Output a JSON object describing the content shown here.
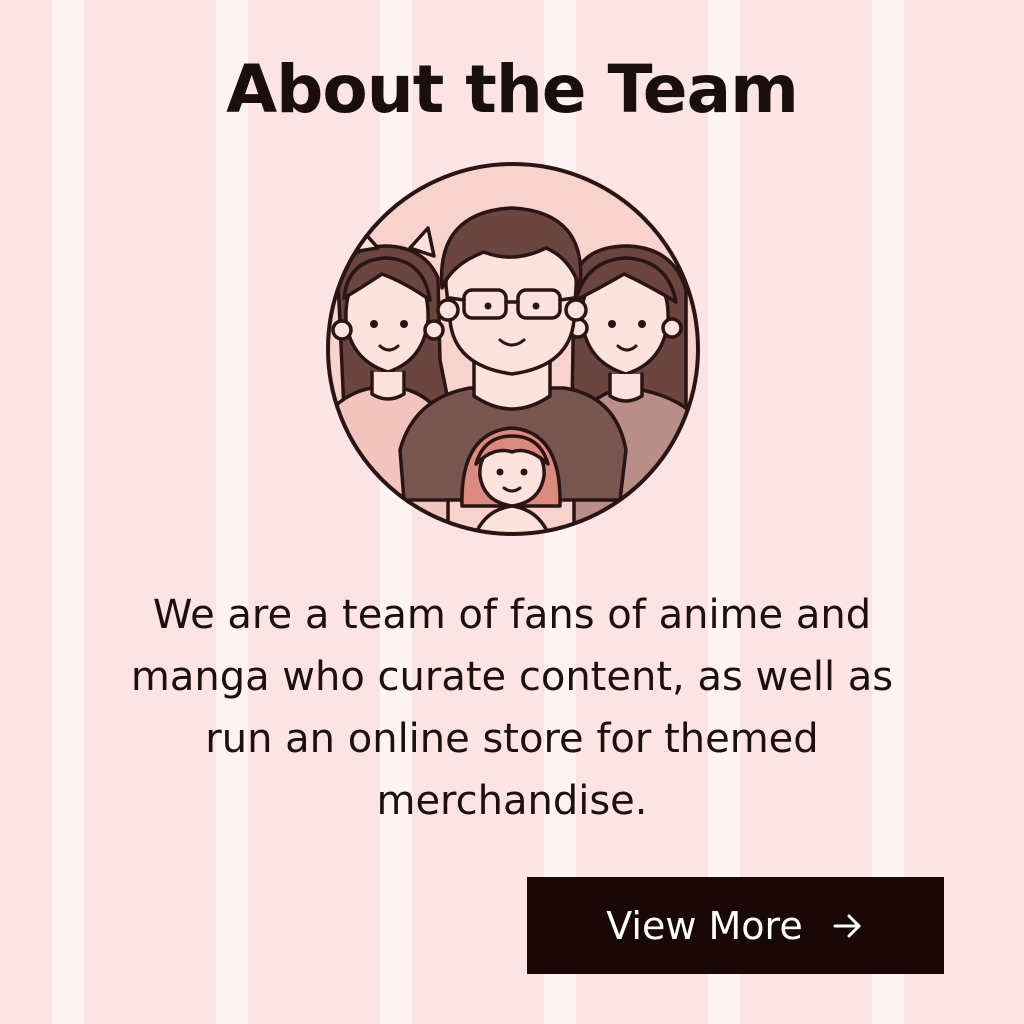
{
  "section": {
    "title": "About the Team",
    "description": "We are a team of fans of anime and manga who curate content, as well as run an online store for themed merchandise."
  },
  "illustration": {
    "icon": "team-family-illustration"
  },
  "cta": {
    "label": "View More",
    "icon": "arrow-right-icon"
  },
  "colors": {
    "background": "#fde4e4",
    "stripe": "#fff4f4",
    "button_bg": "#1a0707",
    "button_text": "#ffffff",
    "text": "#1a0f0f"
  }
}
